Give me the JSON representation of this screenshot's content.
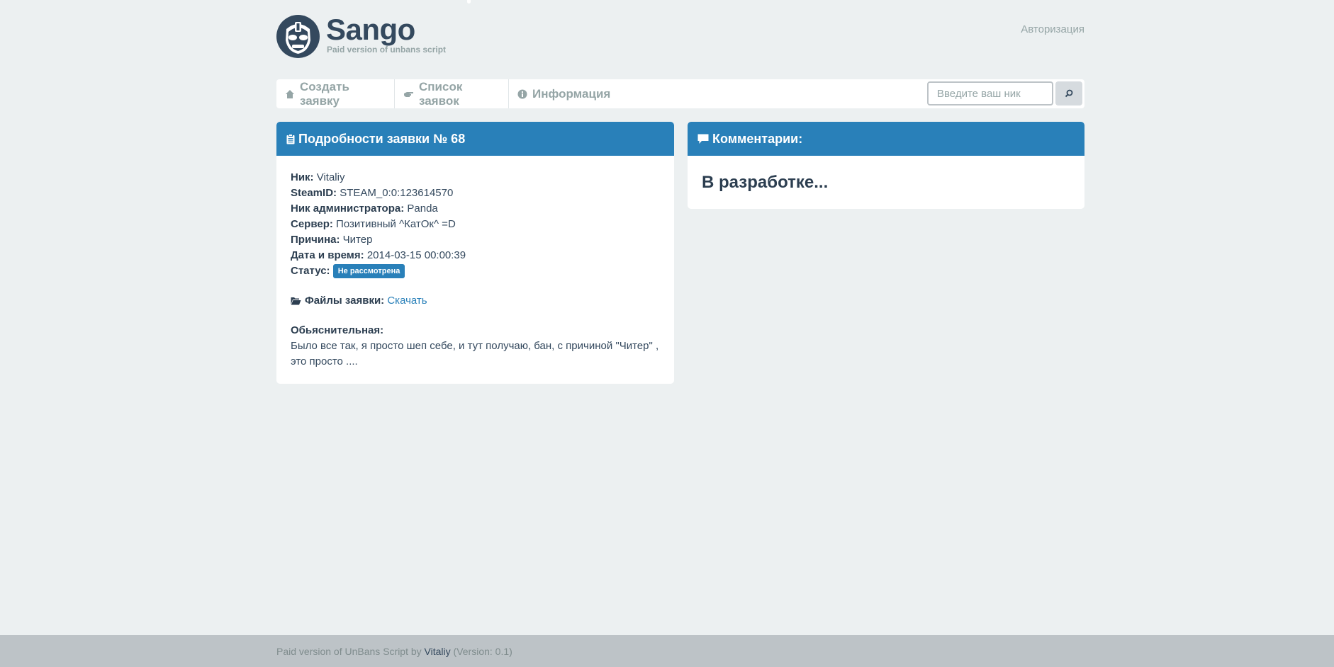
{
  "brand": {
    "title": "Sango",
    "subtitle": "Paid version of unbans script"
  },
  "header": {
    "auth_link": "Авторизация"
  },
  "nav": {
    "items": [
      {
        "label": "Создать заявку",
        "icon": "home-icon"
      },
      {
        "label": "Список заявок",
        "icon": "hand-icon"
      },
      {
        "label": "Информация",
        "icon": "info-icon"
      }
    ],
    "search_placeholder": "Введите ваш ник"
  },
  "details": {
    "title": "Подробности заявки № 68",
    "fields": [
      {
        "label": "Ник:",
        "value": "Vitaliy"
      },
      {
        "label": "SteamID:",
        "value": "STEAM_0:0:123614570"
      },
      {
        "label": "Ник администратора:",
        "value": "Panda"
      },
      {
        "label": "Сервер:",
        "value": "Позитивный ^КатОк^ =D"
      },
      {
        "label": "Причина:",
        "value": "Читер"
      },
      {
        "label": "Дата и время:",
        "value": "2014-03-15 00:00:39"
      }
    ],
    "status_label": "Статус:",
    "status_value": "Не рассмотрена",
    "files_label": "Файлы заявки:",
    "files_link": "Скачать",
    "explanation_title": "Обьяснительная:",
    "explanation_text": "Было все так, я просто шеп себе, и тут получаю, бан, с причиной \"Читер\" , это просто ...."
  },
  "comments": {
    "title": "Комментарии:",
    "body": "В разработке..."
  },
  "footer": {
    "prefix": "Paid version of UnBans Script by",
    "author": "Vitaliy",
    "version": "(Version: 0.1)"
  },
  "colors": {
    "accent": "#2980b9",
    "background": "#ecf0f1",
    "footer": "#bdc3c7"
  }
}
